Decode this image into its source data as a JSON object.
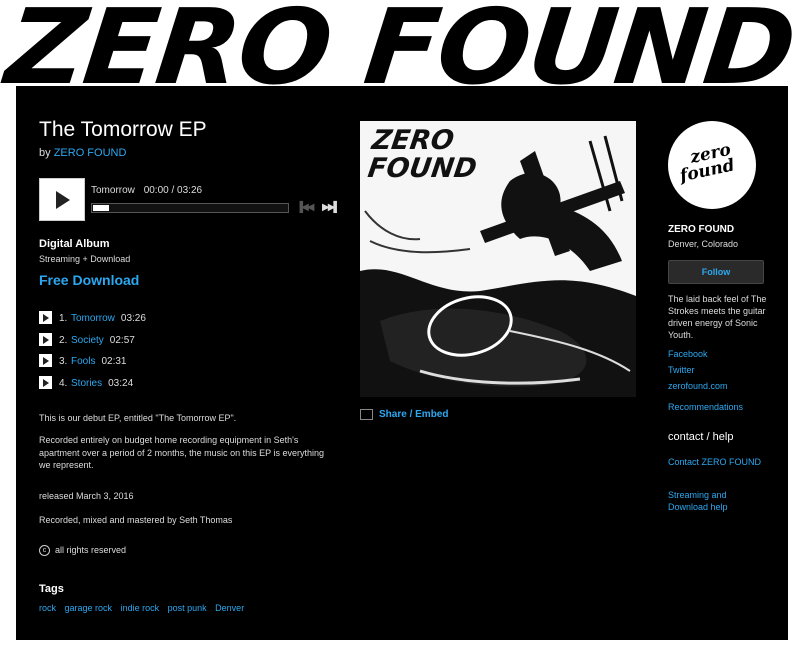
{
  "banner": {
    "title": "ZERO FOUND"
  },
  "album": {
    "title": "The Tomorrow EP",
    "by_prefix": "by",
    "artist_link": "ZERO FOUND"
  },
  "player": {
    "track": "Tomorrow",
    "time": "00:00 / 03:26",
    "progress_fraction": 0.0,
    "prev_icon": "prev-icon",
    "next_icon": "next-icon"
  },
  "purchase": {
    "format": "Digital Album",
    "format_desc": "Streaming + Download",
    "free_download": "Free Download"
  },
  "tracks": [
    {
      "num": "1.",
      "name": "Tomorrow",
      "time": "03:26"
    },
    {
      "num": "2.",
      "name": "Society",
      "time": "02:57"
    },
    {
      "num": "3.",
      "name": "Fools",
      "time": "02:31"
    },
    {
      "num": "4.",
      "name": "Stories",
      "time": "03:24"
    }
  ],
  "description": {
    "p1": "This is our debut EP, entitled \"The Tomorrow EP\".",
    "p2": "Recorded entirely on budget home recording equipment in Seth's apartment over a period of 2 months, the music on this EP is everything we represent."
  },
  "released": "released March 3, 2016",
  "credits": "Recorded, mixed and mastered by Seth Thomas",
  "rights": {
    "icon": "copyright-icon",
    "text": "all rights reserved"
  },
  "tags": {
    "heading": "Tags",
    "items": [
      "rock",
      "garage rock",
      "indie rock",
      "post punk",
      "Denver"
    ]
  },
  "artwork": {
    "text_line1": "ZERO",
    "text_line2": "FOUND"
  },
  "share": {
    "label": "Share / Embed",
    "icon": "share-icon"
  },
  "sidebar": {
    "logo_line1": "zero",
    "logo_line2": "found",
    "artist": "ZERO FOUND",
    "location": "Denver, Colorado",
    "follow": "Follow",
    "bio": "The laid back feel of The Strokes meets the guitar driven energy of Sonic Youth.",
    "links": [
      "Facebook",
      "Twitter",
      "zerofound.com"
    ],
    "recommendations": "Recommendations",
    "contact_heading": "contact / help",
    "contact_link": "Contact ZERO FOUND",
    "help_link": "Streaming and Download help"
  },
  "colors": {
    "link": "#2ca8f0",
    "background": "#000000",
    "banner": "#ffffff"
  }
}
